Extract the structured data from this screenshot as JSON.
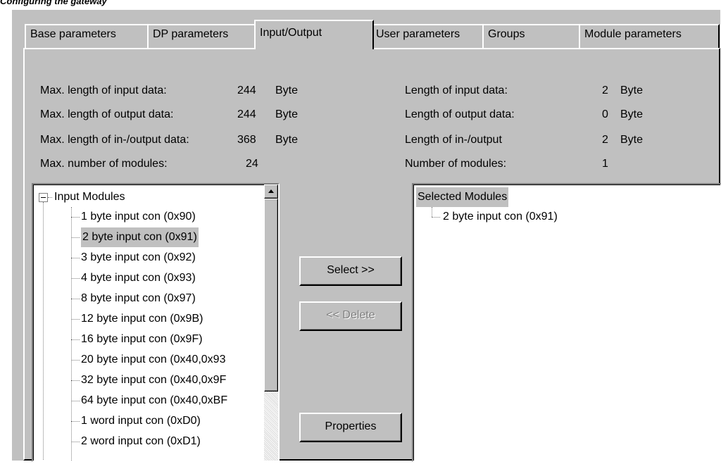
{
  "caption": "Configuring the gateway",
  "tabs": [
    {
      "label": "Base parameters",
      "active": false
    },
    {
      "label": "DP parameters",
      "active": false
    },
    {
      "label": "Input/Output",
      "active": true
    },
    {
      "label": "User parameters",
      "active": false
    },
    {
      "label": "Groups",
      "active": false
    },
    {
      "label": "Module parameters",
      "active": false
    }
  ],
  "limits": {
    "max_input": {
      "label": "Max. length of input data:",
      "value": "244",
      "unit": "Byte"
    },
    "max_output": {
      "label": "Max. length of output data:",
      "value": "244",
      "unit": "Byte"
    },
    "max_inout": {
      "label": "Max. length of in-/output data:",
      "value": "368",
      "unit": "Byte"
    },
    "max_modules": {
      "label": "Max. number of modules:",
      "value": "24"
    }
  },
  "current": {
    "input": {
      "label": "Length of input data:",
      "value": "2",
      "unit": "Byte"
    },
    "output": {
      "label": "Length of output data:",
      "value": "0",
      "unit": "Byte"
    },
    "inout": {
      "label": "Length of in-/output",
      "value": "2",
      "unit": "Byte"
    },
    "modules": {
      "label": "Number of modules:",
      "value": "1"
    }
  },
  "available": {
    "root": "Input Modules",
    "items": [
      "1  byte input con  (0x90)",
      "2  byte input con  (0x91)",
      "3  byte input con  (0x92)",
      "4  byte input con  (0x93)",
      "8  byte input con  (0x97)",
      "12 byte input con  (0x9B)",
      "16 byte input con  (0x9F)",
      "20 byte input con  (0x40,0x93",
      "32 byte input con  (0x40,0x9F",
      "64 byte input con  (0x40,0xBF",
      "1  word input con  (0xD0)",
      "2  word input con  (0xD1)"
    ],
    "selected_index": 1
  },
  "selected": {
    "root": "Selected Modules",
    "items": [
      "2  byte input con  (0x91)"
    ]
  },
  "buttons": {
    "select": "Select >>",
    "delete": "<< Delete",
    "properties": "Properties"
  }
}
